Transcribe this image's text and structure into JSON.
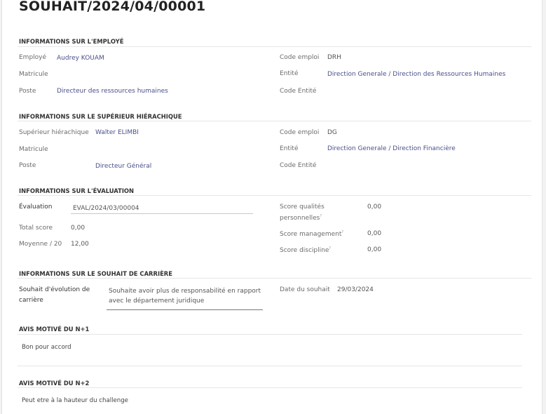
{
  "title": "SOUHAIT/2024/04/00001",
  "employee_section": {
    "heading": "INFORMATIONS SUR L'EMPLOYÉ",
    "employee_label": "Employé",
    "employee_value": "Audrey KOUAM",
    "matricule_label": "Matricule",
    "poste_label": "Poste",
    "poste_value": "Directeur des ressources humaines",
    "code_emploi_label": "Code emploi",
    "code_emploi_value": "DRH",
    "entite_label": "Entité",
    "entite_value": "Direction Generale / Direction des Ressources Humaines",
    "code_entite_label": "Code Entité"
  },
  "superior_section": {
    "heading": "INFORMATIONS SUR LE SUPÉRIEUR HIÉRACHIQUE",
    "superior_label": "Supérieur hiérachique",
    "superior_value": "Walter ELIMBI",
    "matricule_label": "Matricule",
    "poste_label": "Poste",
    "poste_value": "Directeur Général",
    "code_emploi_label": "Code emploi",
    "code_emploi_value": "DG",
    "entite_label": "Entité",
    "entite_value": "Direction Generale / Direction Financière",
    "code_entite_label": "Code Entité"
  },
  "evaluation_section": {
    "heading": "INFORMATIONS SUR L'ÉVALUATION",
    "evaluation_label": "Évaluation",
    "evaluation_value": "EVAL/2024/03/00004",
    "total_label": "Total score",
    "total_value": "0,00",
    "moyenne_label": "Moyenne / 20",
    "moyenne_value": "12,00",
    "qualites_label_1": "Score qualités",
    "qualites_label_2": "personnelles",
    "qualites_value": "0,00",
    "management_label": "Score management",
    "management_value": "0,00",
    "discipline_label": "Score discipline",
    "discipline_value": "0,00",
    "help_mark": "?"
  },
  "career_section": {
    "heading": "INFORMATIONS SUR LE SOUHAIT DE CARRIÈRE",
    "wish_label_1": "Souhait d'évolution de",
    "wish_label_2": "carrière",
    "wish_value_1": "Souhaite avoir plus de responsabilité en rapport",
    "wish_value_2": "avec le département juridique",
    "date_label": "Date du souhait",
    "date_value": "29/03/2024"
  },
  "n1_section": {
    "heading": "AVIS MOTIVÉ DU N+1",
    "text": "Bon pour accord"
  },
  "n2_section": {
    "heading": "AVIS MOTIVÉ DU N+2",
    "text": "Peut etre à la hauteur du challenge"
  }
}
